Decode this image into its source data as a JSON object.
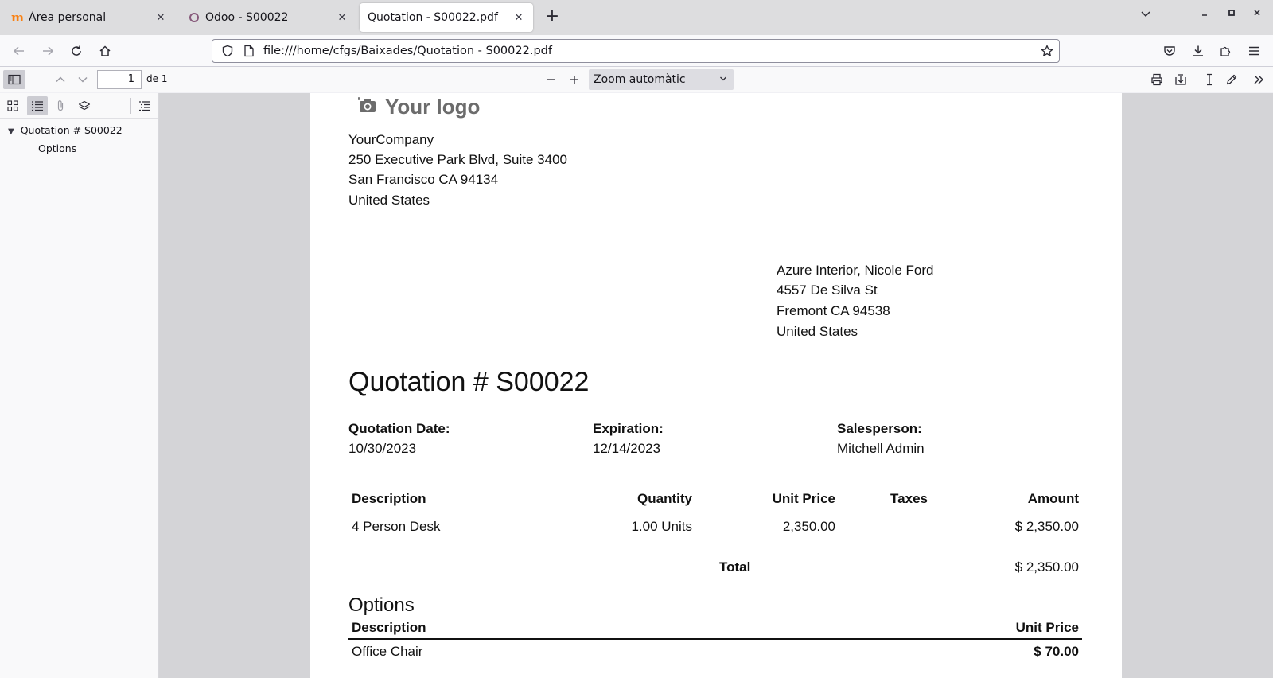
{
  "browser": {
    "tabs": [
      {
        "title": "Àrea personal",
        "favicon": "moodle-icon",
        "active": false
      },
      {
        "title": "Odoo - S00022",
        "favicon": "odoo-icon",
        "active": false
      },
      {
        "title": "Quotation - S00022.pdf",
        "favicon": "",
        "active": true
      }
    ],
    "url": "file:///home/cfgs/Baixades/Quotation - S00022.pdf"
  },
  "pdf_toolbar": {
    "page_number": "1",
    "page_count": "de 1",
    "zoom": "Zoom automàtic"
  },
  "outline": {
    "items": [
      {
        "label": "Quotation # S00022"
      },
      {
        "label": "Options"
      }
    ]
  },
  "document": {
    "logo_text": "Your logo",
    "company": {
      "name": "YourCompany",
      "street": "250 Executive Park Blvd, Suite 3400",
      "city": "San Francisco CA 94134",
      "country": "United States"
    },
    "customer": {
      "name": "Azure Interior, Nicole Ford",
      "street": "4557 De Silva St",
      "city": "Fremont CA 94538",
      "country": "United States"
    },
    "title": "Quotation # S00022",
    "info": [
      {
        "label": "Quotation Date:",
        "value": "10/30/2023"
      },
      {
        "label": "Expiration:",
        "value": "12/14/2023"
      },
      {
        "label": "Salesperson:",
        "value": "Mitchell Admin"
      }
    ],
    "table": {
      "headers": [
        "Description",
        "Quantity",
        "Unit Price",
        "Taxes",
        "Amount"
      ],
      "rows": [
        {
          "description": "4 Person Desk",
          "quantity": "1.00 Units",
          "unit_price": "2,350.00",
          "taxes": "",
          "amount": "$ 2,350.00"
        }
      ],
      "total_label": "Total",
      "total_value": "$ 2,350.00"
    },
    "options": {
      "title": "Options",
      "headers": [
        "Description",
        "Unit Price"
      ],
      "rows": [
        {
          "description": "Office Chair",
          "unit_price": "$ 70.00"
        }
      ]
    }
  }
}
